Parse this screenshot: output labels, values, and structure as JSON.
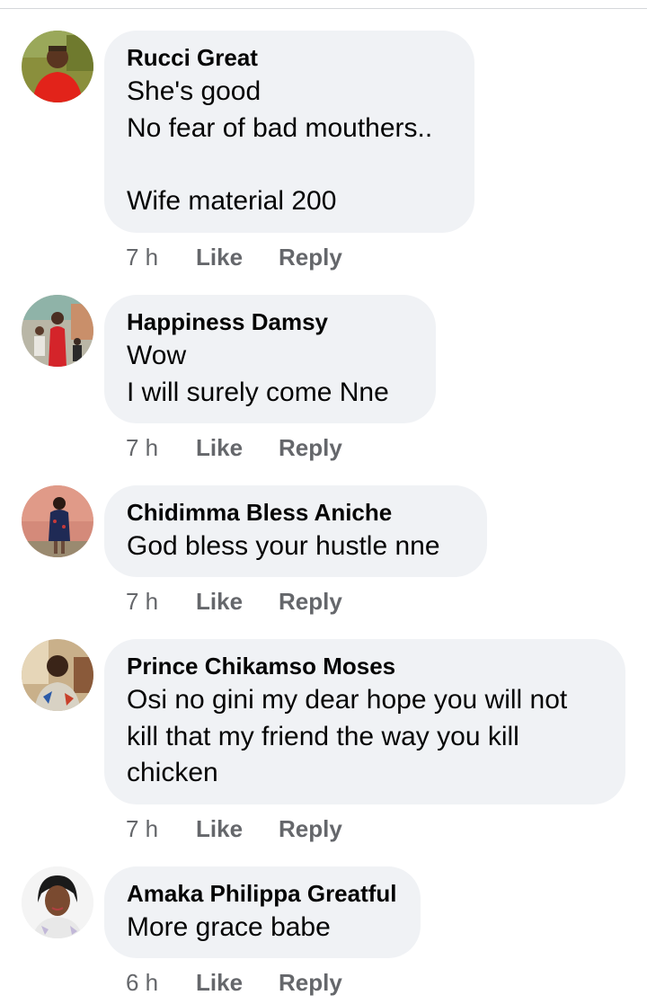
{
  "comments": [
    {
      "author": "Rucci Great",
      "text": "She's good\nNo fear of bad mouthers..\n\nWife material 200",
      "time": "7 h",
      "like_label": "Like",
      "reply_label": "Reply"
    },
    {
      "author": "Happiness Damsy",
      "text": "Wow\nI will surely come Nne",
      "time": "7 h",
      "like_label": "Like",
      "reply_label": "Reply"
    },
    {
      "author": "Chidimma Bless Aniche",
      "text": "God bless your hustle nne",
      "time": "7 h",
      "like_label": "Like",
      "reply_label": "Reply"
    },
    {
      "author": "Prince Chikamso Moses",
      "text": "Osi no gini my dear hope you will not\nkill that my friend the way you kill\nchicken",
      "time": "7 h",
      "like_label": "Like",
      "reply_label": "Reply"
    },
    {
      "author": "Amaka Philippa Greatful",
      "text": "More grace babe",
      "time": "6 h",
      "like_label": "Like",
      "reply_label": "Reply"
    }
  ],
  "colors": {
    "bubble_bg": "#f0f2f5",
    "text": "#050505",
    "meta": "#65676b"
  }
}
